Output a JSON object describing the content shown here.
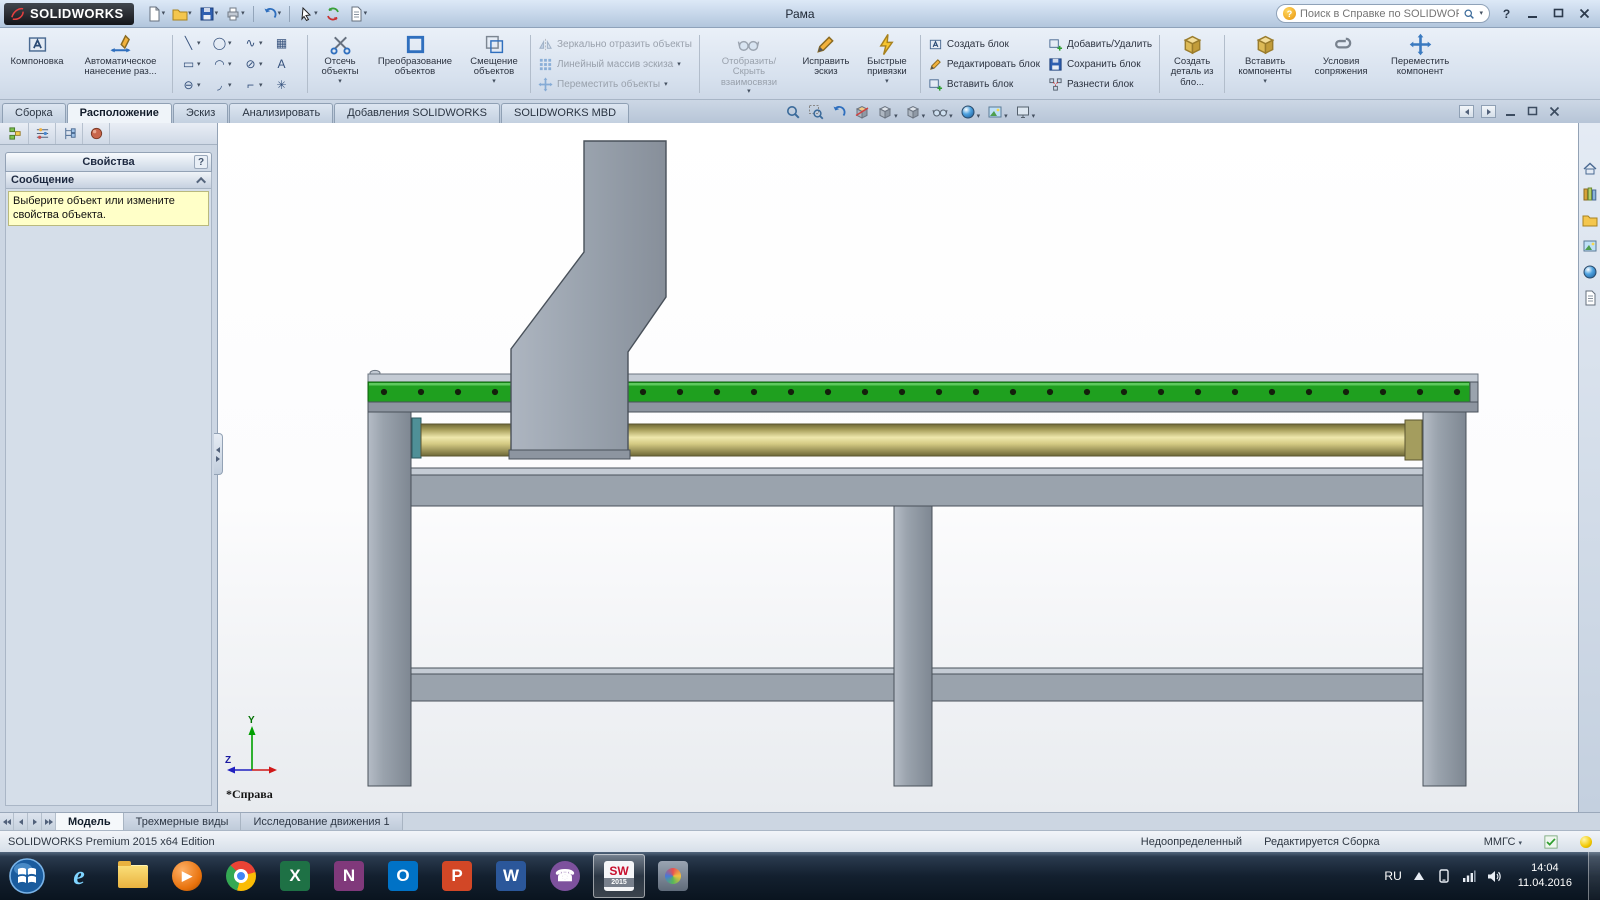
{
  "titlebar": {
    "brand": "SOLIDWORKS",
    "doc_title": "Рама",
    "search_placeholder": "Поиск в Справке по SOLIDWORKS",
    "help_glyph": "?"
  },
  "quick_access_icons": [
    "new-document",
    "open",
    "save",
    "print",
    "undo",
    "select-cursor",
    "rebuild",
    "file-properties"
  ],
  "ribbon": {
    "buttons": {
      "layout": "Компоновка",
      "autodim": "Автоматическое нанесение раз...",
      "trim": "Отсечь объекты",
      "convert": "Преобразование объектов",
      "offset": "Смещение объектов",
      "mirror": "Зеркально отразить объекты",
      "linear_pattern": "Линейный массив эскиза",
      "move": "Переместить объекты",
      "relations": "Отобразить/Скрыть взаимосвязи",
      "repair": "Исправить эскиз",
      "snaps": "Быстрые привязки",
      "make_block": "Создать блок",
      "edit_block": "Редактировать блок",
      "insert_block": "Вставить блок",
      "add_remove": "Добавить/Удалить",
      "save_block": "Сохранить блок",
      "explode_block": "Разнести блок",
      "part_from_block": "Создать деталь из бло...",
      "insert_components": "Вставить компоненты",
      "mates": "Условия сопряжения",
      "move_component": "Переместить компонент"
    },
    "disabled": {
      "mirror": true,
      "linear_pattern": true,
      "move": true,
      "relations": true
    },
    "sketch_tools": [
      {
        "name": "line-tool",
        "glyph": "╲"
      },
      {
        "name": "circle-tool",
        "glyph": "◯"
      },
      {
        "name": "spline-tool",
        "glyph": "∿"
      },
      {
        "name": "convert-grid-tool",
        "glyph": "▦"
      },
      {
        "name": "rectangle-tool",
        "glyph": "▭"
      },
      {
        "name": "arc-tool",
        "glyph": "◠"
      },
      {
        "name": "ellipse-tool",
        "glyph": "⊘"
      },
      {
        "name": "text-tool",
        "glyph": "A"
      },
      {
        "name": "slot-tool",
        "glyph": "⊖"
      },
      {
        "name": "fillet-tool",
        "glyph": "◞"
      },
      {
        "name": "chamfer-tool",
        "glyph": "⌐"
      },
      {
        "name": "point-tool",
        "glyph": "✳"
      }
    ]
  },
  "command_tabs": {
    "items": [
      {
        "label": "Сборка",
        "active": false
      },
      {
        "label": "Расположение",
        "active": true
      },
      {
        "label": "Эскиз",
        "active": false
      },
      {
        "label": "Анализировать",
        "active": false
      },
      {
        "label": "Добавления SOLIDWORKS",
        "active": false
      },
      {
        "label": "SOLIDWORKS MBD",
        "active": false
      }
    ]
  },
  "headsup_icons": [
    "zoom-fit",
    "zoom-area",
    "previous-view",
    "section-view",
    "view-orientation",
    "display-style",
    "hide-show-items",
    "edit-appearance",
    "apply-scene",
    "view-settings"
  ],
  "panel": {
    "tab_icons": [
      "featuremanager",
      "propertymanager",
      "configurationmanager",
      "appearances"
    ],
    "title": "Свойства",
    "help_glyph": "?",
    "message_header": "Сообщение",
    "message_text": "Выберите объект или измените свойства объекта."
  },
  "viewport": {
    "view_label": "*Справа",
    "axes": {
      "y": "Y",
      "z": "Z"
    }
  },
  "model": {
    "frame_color": "#9aa3ad",
    "frame_light": "#c4cbd4",
    "frame_dark": "#8d95a0",
    "outline": "#49515a",
    "rail_green": "#1fa01f",
    "rail_green_dark": "#0b5c0b",
    "bracket_teal": "#4f9097",
    "shaft_cap": "#a49d5e",
    "rail_hole_count": 30,
    "rail_hole_color": "#14200c"
  },
  "taskpane_icons": [
    "solidworks-resources",
    "design-library",
    "file-explorer",
    "view-palette",
    "appearances-scenes",
    "custom-properties"
  ],
  "model_tabs": {
    "items": [
      {
        "label": "Модель",
        "active": true
      },
      {
        "label": "Трехмерные виды",
        "active": false
      },
      {
        "label": "Исследование движения 1",
        "active": false
      }
    ]
  },
  "statusbar": {
    "product": "SOLIDWORKS Premium 2015 x64 Edition",
    "constraint_state": "Недоопределенный",
    "edit_state": "Редактируется Сборка",
    "units": "ММГС"
  },
  "taskbar": {
    "language": "RU",
    "time": "14:04",
    "date": "11.04.2016",
    "tray_icons": [
      "hidden-icons",
      "phone",
      "network",
      "volume"
    ],
    "apps": [
      {
        "name": "internet-explorer",
        "glyph": "e",
        "fg": "#7fd4ff",
        "bg": "transparent",
        "active": false
      },
      {
        "name": "windows-explorer",
        "glyph": "",
        "fg": "",
        "bg": "",
        "active": false
      },
      {
        "name": "media-player",
        "glyph": "▶",
        "fg": "#ffffff",
        "bg": "",
        "active": false
      },
      {
        "name": "chrome",
        "glyph": "",
        "fg": "",
        "bg": "",
        "active": false
      },
      {
        "name": "excel",
        "glyph": "X",
        "fg": "#ffffff",
        "bg": "#1e7145",
        "active": false
      },
      {
        "name": "onenote",
        "glyph": "N",
        "fg": "#ffffff",
        "bg": "#80397b",
        "active": false
      },
      {
        "name": "outlook",
        "glyph": "O",
        "fg": "#ffffff",
        "bg": "#0072c6",
        "active": false
      },
      {
        "name": "powerpoint",
        "glyph": "P",
        "fg": "#ffffff",
        "bg": "#d24726",
        "active": false
      },
      {
        "name": "word",
        "glyph": "W",
        "fg": "#ffffff",
        "bg": "#2b579a",
        "active": false
      },
      {
        "name": "viber",
        "glyph": "☎",
        "fg": "#ffffff",
        "bg": "#7d519d",
        "active": false
      },
      {
        "name": "solidworks-2015",
        "glyph": "SW",
        "sub": "2015",
        "fg": "#c8102e",
        "bg": "#f5f6f8",
        "active": true
      },
      {
        "name": "paint",
        "glyph": "",
        "fg": "",
        "bg": "",
        "active": false
      }
    ]
  }
}
